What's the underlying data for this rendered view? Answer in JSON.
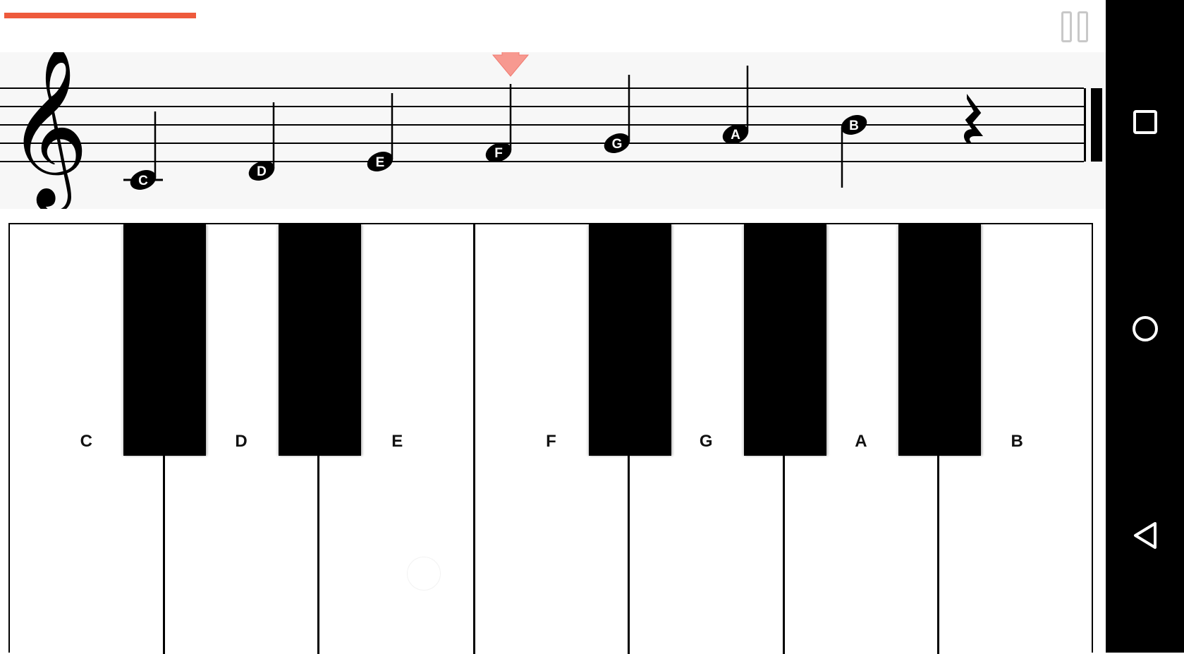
{
  "progress": {
    "fraction": 0.162
  },
  "icons": {
    "pause": "pause-icon",
    "treble_clef": "treble-clef-icon",
    "arrow": "down-arrow-icon",
    "rest": "quarter-rest-icon",
    "recent": "square-icon",
    "home": "circle-icon",
    "back": "triangle-back-icon"
  },
  "colors": {
    "progress": "#ee5a3c",
    "arrow": "#f79990",
    "staff_bg": "#f7f7f7",
    "nav_bg": "#000000"
  },
  "staff": {
    "current_note_index": 3,
    "notes": [
      {
        "label": "C"
      },
      {
        "label": "D"
      },
      {
        "label": "E"
      },
      {
        "label": "F"
      },
      {
        "label": "G"
      },
      {
        "label": "A"
      },
      {
        "label": "B"
      }
    ]
  },
  "piano": {
    "white_keys": [
      {
        "label": "C"
      },
      {
        "label": "D"
      },
      {
        "label": "E"
      },
      {
        "label": "F"
      },
      {
        "label": "G"
      },
      {
        "label": "A"
      },
      {
        "label": "B"
      }
    ]
  }
}
